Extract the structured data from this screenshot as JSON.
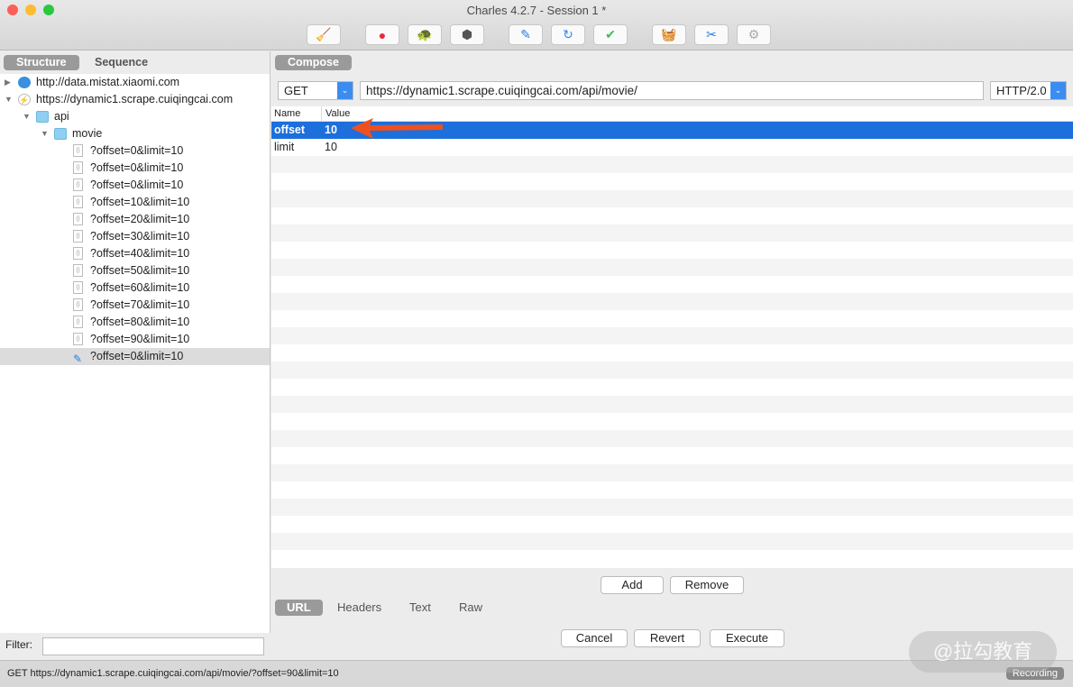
{
  "window": {
    "title": "Charles 4.2.7 - Session 1 *"
  },
  "toolbar": [
    {
      "name": "broom-icon",
      "g": "🧹",
      "c": "#e8b400"
    },
    {
      "name": "record-icon",
      "g": "●",
      "c": "#e8283c"
    },
    {
      "name": "throttle-turtle-icon",
      "g": "🐢",
      "c": "#555"
    },
    {
      "name": "breakpoint-hexagon-icon",
      "g": "⬢",
      "c": "#555"
    },
    {
      "name": "compose-pen-icon",
      "g": "✎",
      "c": "#2a7de1"
    },
    {
      "name": "repeat-icon",
      "g": "↻",
      "c": "#2a8de8"
    },
    {
      "name": "validate-check-icon",
      "g": "✔",
      "c": "#44b860"
    },
    {
      "name": "basket-icon",
      "g": "🧺",
      "c": "#44b860"
    },
    {
      "name": "tools-icon",
      "g": "✂",
      "c": "#2a7de1"
    },
    {
      "name": "settings-gear-icon",
      "g": "⚙",
      "c": "#aaa"
    }
  ],
  "left": {
    "tabs": [
      "Structure",
      "Sequence"
    ],
    "hosts": [
      "http://data.mistat.xiaomi.com",
      "https://dynamic1.scrape.cuiqingcai.com"
    ],
    "folders": [
      "api",
      "movie"
    ],
    "requests": [
      "?offset=0&limit=10",
      "?offset=0&limit=10",
      "?offset=0&limit=10",
      "?offset=10&limit=10",
      "?offset=20&limit=10",
      "?offset=30&limit=10",
      "?offset=40&limit=10",
      "?offset=50&limit=10",
      "?offset=60&limit=10",
      "?offset=70&limit=10",
      "?offset=80&limit=10",
      "?offset=90&limit=10",
      "?offset=0&limit=10"
    ],
    "filter_label": "Filter:"
  },
  "compose": {
    "tab": "Compose",
    "method": "GET",
    "url": "https://dynamic1.scrape.cuiqingcai.com/api/movie/",
    "protocol": "HTTP/2.0",
    "columns": [
      "Name",
      "Value"
    ],
    "params": [
      {
        "name": "offset",
        "value": "10"
      },
      {
        "name": "limit",
        "value": "10"
      }
    ],
    "add": "Add",
    "remove": "Remove",
    "tabs": [
      "URL",
      "Headers",
      "Text",
      "Raw"
    ],
    "cancel": "Cancel",
    "revert": "Revert",
    "execute": "Execute"
  },
  "status": {
    "text": "GET https://dynamic1.scrape.cuiqingcai.com/api/movie/?offset=90&limit=10",
    "recording": "Recording"
  },
  "watermark": "@拉勾教育",
  "colors": {
    "selection": "#1d6fdc",
    "arrow": "#f0501e"
  }
}
